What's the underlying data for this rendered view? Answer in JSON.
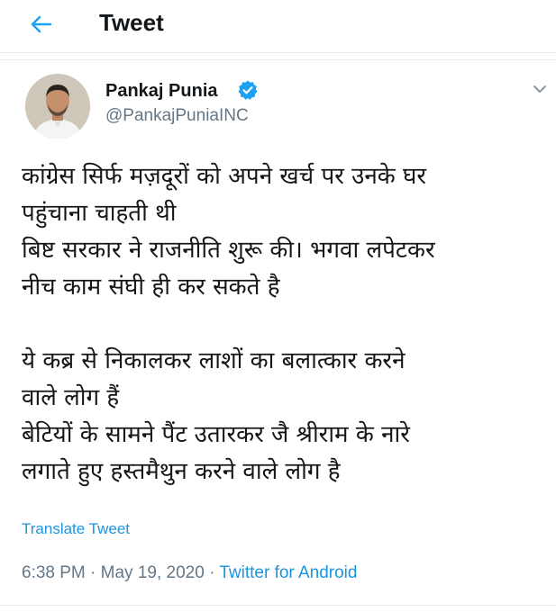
{
  "header": {
    "title": "Tweet",
    "back_icon": "arrow-left-icon"
  },
  "author": {
    "name": "Pankaj Punia",
    "handle": "@PankajPuniaINC",
    "verified": true,
    "verified_icon": "verified-badge-icon"
  },
  "tweet": {
    "paragraphs": [
      "कांग्रेस सिर्फ मज़दूरों को अपने खर्च पर उनके घर\nपहुंचाना चाहती थी\nबिष्ट सरकार ने राजनीति शुरू की। भगवा लपेटकर\nनीच काम संघी ही कर सकते है",
      "ये कब्र से निकालकर लाशों का बलात्कार करने\nवाले लोग हैं\nबेटियों के सामने पैंट उतारकर जै श्रीराम के नारे\nलगाते हुए हस्तमैथुन करने वाले लोग है"
    ],
    "translate_label": "Translate Tweet"
  },
  "meta": {
    "time": "6:38 PM",
    "separator": " · ",
    "date": "May 19, 2020",
    "source": "Twitter for Android"
  },
  "colors": {
    "accent": "#1b95e0",
    "text": "#14171a",
    "muted": "#657786"
  }
}
